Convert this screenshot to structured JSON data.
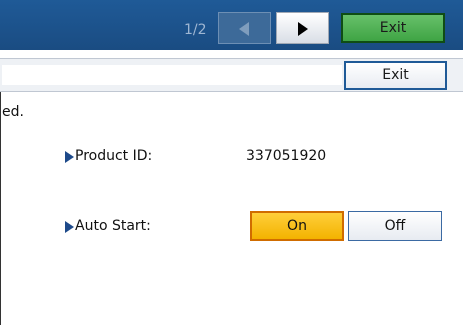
{
  "header": {
    "page_indicator": "1/2",
    "prev_icon": "triangle-left-icon",
    "next_icon": "triangle-right-icon",
    "exit_label": "Exit"
  },
  "toolbar": {
    "exit_label": "Exit"
  },
  "message": {
    "text": "ed."
  },
  "settings": {
    "product_id": {
      "label": "Product ID:",
      "value": "337051920"
    },
    "auto_start": {
      "label": "Auto Start:",
      "options": [
        "On",
        "Off"
      ],
      "selected": "On"
    }
  },
  "colors": {
    "header_bg": "#1f5a97",
    "exit_green": "#4caf50",
    "selected_orange": "#f5b400",
    "marker_blue": "#1e4a8a"
  }
}
